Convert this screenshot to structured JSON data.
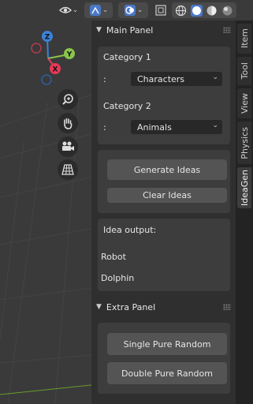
{
  "main_panel": {
    "title": "Main Panel",
    "category1_label": "Category 1",
    "category1_prefix": ":",
    "category1_value": "Characters",
    "category2_label": "Category 2",
    "category2_prefix": ":",
    "category2_value": "Animals",
    "generate_label": "Generate Ideas",
    "clear_label": "Clear Ideas",
    "output_label": "Idea output:",
    "outputs": [
      "Robot",
      "Dolphin"
    ]
  },
  "extra_panel": {
    "title": "Extra Panel",
    "single_label": "Single Pure Random",
    "double_label": "Double Pure Random"
  },
  "tabs": [
    "Item",
    "Tool",
    "View",
    "Physics",
    "IdeaGen"
  ],
  "active_tab": "IdeaGen",
  "gizmo": {
    "x": "X",
    "y": "Y",
    "z": "Z"
  },
  "colors": {
    "x_axis": "#e8385a",
    "y_axis": "#8bc34a",
    "z_axis": "#3b82d6",
    "grid_green": "#6b9a2e",
    "grid_red": "#9a3a3a"
  }
}
